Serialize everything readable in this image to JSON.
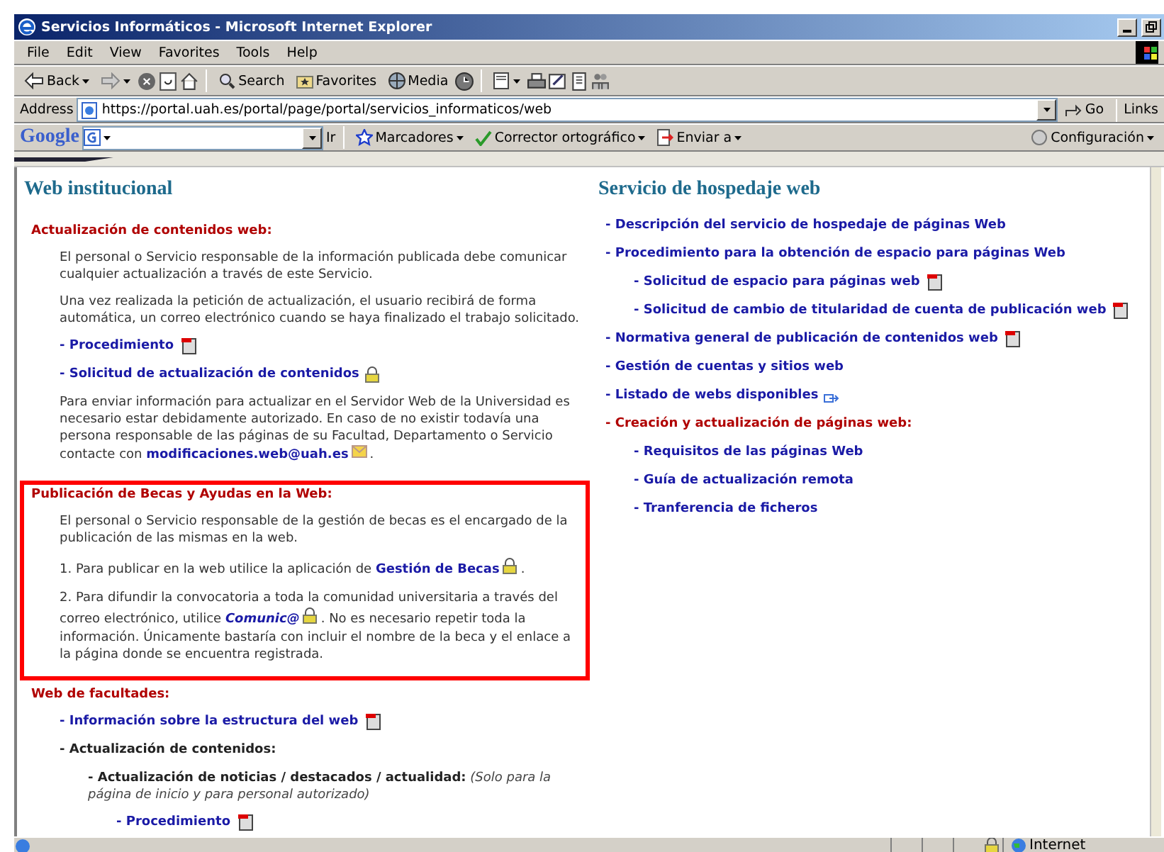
{
  "window": {
    "title": "Servicios Informáticos - Microsoft Internet Explorer"
  },
  "menu": [
    "File",
    "Edit",
    "View",
    "Favorites",
    "Tools",
    "Help"
  ],
  "toolbar": [
    "Back",
    "Search",
    "Favorites",
    "Media"
  ],
  "address": {
    "label": "Address",
    "url": "https://portal.uah.es/portal/page/portal/servicios_informaticos/web",
    "go": "Go",
    "links": "Links"
  },
  "google": {
    "logo": "Google",
    "go": "Ir",
    "buttons": [
      "Marcadores",
      "Corrector ortográfico",
      "Enviar a"
    ],
    "settings": "Configuración"
  },
  "left": {
    "title": "Web institucional",
    "sections": [
      {
        "heading": "Actualización de contenidos web:",
        "highlighted": false,
        "blocks": [
          {
            "kind": "paragraph",
            "segments": [
              {
                "kind": "text",
                "text": "El personal o Servicio responsable de la información publicada debe comunicar cualquier actualización a través de este Servicio."
              }
            ]
          },
          {
            "kind": "paragraph",
            "segments": [
              {
                "kind": "text",
                "text": "Una vez realizada la petición de actualización, el usuario recibirá de forma automática, un correo electrónico cuando se haya finalizado el trabajo solicitado."
              }
            ]
          },
          {
            "kind": "pdf-link",
            "text": "- Procedimiento"
          },
          {
            "kind": "lock-link",
            "text": "- Solicitud de actualización de contenidos"
          },
          {
            "kind": "paragraph",
            "segments": [
              {
                "kind": "text",
                "text": "Para enviar información para actualizar en el Servidor Web de la Universidad es necesario estar debidamente autorizado. En caso de no existir todavía una persona responsable de las páginas de su Facultad, Departamento o Servicio contacte con "
              },
              {
                "kind": "link",
                "text": "modificaciones.web@uah.es"
              },
              {
                "kind": "mail"
              },
              {
                "kind": "text",
                "text": "."
              }
            ]
          }
        ]
      },
      {
        "heading": "Publicación de Becas y Ayudas en la Web:",
        "highlighted": true,
        "blocks": [
          {
            "kind": "paragraph",
            "segments": [
              {
                "kind": "text",
                "text": "El personal o Servicio responsable de la gestión de becas es el encargado de la publicación de las mismas en la web."
              }
            ]
          },
          {
            "kind": "paragraph",
            "segments": [
              {
                "kind": "text",
                "text": "1. Para publicar en la web utilice la aplicación de "
              },
              {
                "kind": "link",
                "text": "Gestión de Becas"
              },
              {
                "kind": "lock"
              },
              {
                "kind": "text",
                "text": "."
              }
            ]
          },
          {
            "kind": "paragraph",
            "segments": [
              {
                "kind": "text",
                "text": "2. Para difundir la convocatoria a toda la comunidad universitaria a través del correo electrónico, utilice "
              },
              {
                "kind": "italic-link",
                "text": "Comunic@"
              },
              {
                "kind": "lock"
              },
              {
                "kind": "text",
                "text": ". No es necesario repetir toda la información. Únicamente bastaría con incluir el nombre de la beca y el enlace a la página donde se encuentra registrada."
              }
            ]
          }
        ]
      },
      {
        "heading": "Web de facultades:",
        "highlighted": false,
        "blocks": [
          {
            "kind": "pdf-link",
            "text": "- Información sobre la estructura del web"
          },
          {
            "kind": "label",
            "text": "- Actualización de contenidos:",
            "children": [
              {
                "kind": "paragraph",
                "segments": [
                  {
                    "kind": "bold",
                    "text": "- Actualización de noticias / destacados / actualidad:"
                  },
                  {
                    "kind": "italic",
                    "text": " (Solo para la página de inicio y para personal autorizado)"
                  }
                ],
                "children": [
                  {
                    "kind": "pdf-link",
                    "text": "- Procedimiento"
                  }
                ]
              }
            ]
          }
        ]
      }
    ]
  },
  "right": {
    "title": "Servicio de hospedaje web",
    "items": [
      {
        "kind": "link",
        "text": "- Descripción del servicio de hospedaje de páginas Web"
      },
      {
        "kind": "link",
        "text": "- Procedimiento para la obtención de espacio para páginas Web",
        "children": [
          {
            "kind": "pdf-link",
            "text": "- Solicitud de espacio para páginas web"
          },
          {
            "kind": "pdf-link",
            "text": "- Solicitud de cambio de titularidad de cuenta de publicación web"
          }
        ]
      },
      {
        "kind": "pdf-link",
        "text": "- Normativa general de publicación de contenidos web"
      },
      {
        "kind": "link",
        "text": "- Gestión de cuentas y sitios web"
      },
      {
        "kind": "external-link",
        "text": "- Listado de webs disponibles"
      },
      {
        "kind": "heading",
        "text": "- Creación y actualización de páginas web:",
        "children": [
          {
            "kind": "link",
            "text": "- Requisitos de las páginas Web"
          },
          {
            "kind": "link",
            "text": "- Guía de actualización remota"
          },
          {
            "kind": "link",
            "text": "- Tranferencia de ficheros"
          }
        ]
      }
    ]
  },
  "status": {
    "zone": "Internet"
  }
}
